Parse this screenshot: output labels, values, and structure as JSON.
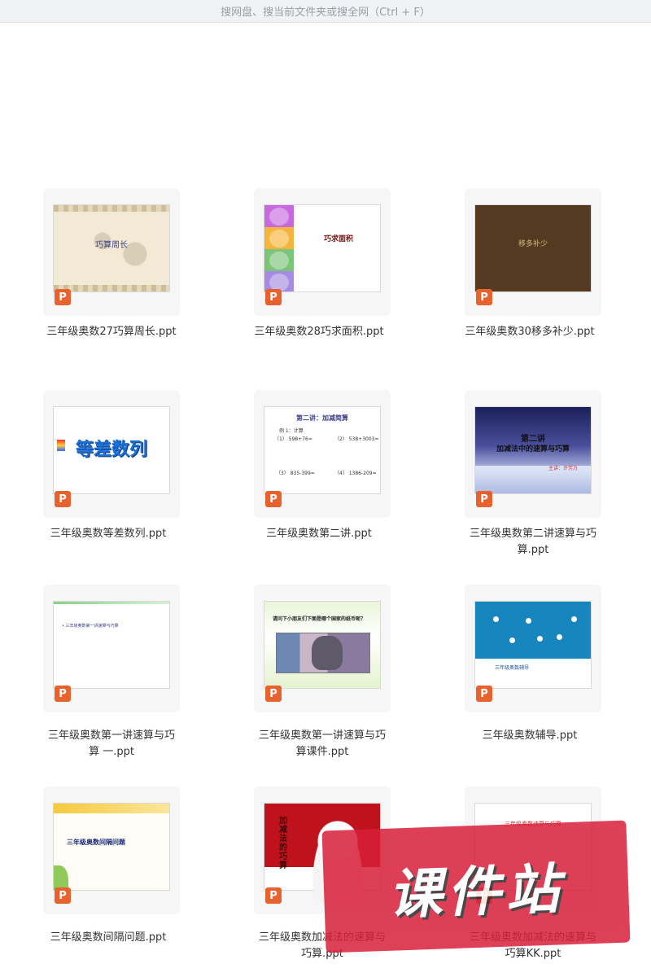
{
  "search": {
    "hint": "搜网盘、搜当前文件夹或搜全网（Ctrl + F）"
  },
  "files": [
    {
      "name": "三年级奥数27巧算周长.ppt",
      "thumb_title": "巧算周长",
      "icon": "ppt-icon"
    },
    {
      "name": "三年级奥数28巧求面积.ppt",
      "thumb_title": "巧求面积",
      "icon": "ppt-icon"
    },
    {
      "name": "三年级奥数30移多补少.ppt",
      "thumb_title": "移多补少",
      "icon": "ppt-icon"
    },
    {
      "name": "三年级奥数等差数列.ppt",
      "thumb_title": "等差数列",
      "icon": "ppt-icon"
    },
    {
      "name": "三年级奥数第二讲.ppt",
      "thumb_title": "第二讲：加减简算",
      "thumb_lines": [
        "例 1：计算",
        "（1） 598+76=",
        "（2） 538+3003=",
        "（3） 835-399=",
        "（4） 1386-209="
      ],
      "icon": "ppt-icon"
    },
    {
      "name": "三年级奥数第二讲速算与巧算.ppt",
      "thumb_title": "第二讲",
      "thumb_subtitle": "加减法中的速算与巧算",
      "thumb_author": "主讲：许芳方",
      "icon": "ppt-icon"
    },
    {
      "name": "三年级奥数第一讲速算与巧算 一.ppt",
      "thumb_title": "三年级奥数第一讲速算与巧算",
      "icon": "ppt-icon"
    },
    {
      "name": "三年级奥数第一讲速算与巧算课件.ppt",
      "thumb_title": "请问下小朋友们下面是哪个国家的纸币呢？",
      "icon": "ppt-icon"
    },
    {
      "name": "三年级奥数辅导.ppt",
      "thumb_title": "三年级奥数辅导",
      "icon": "ppt-icon"
    },
    {
      "name": "三年级奥数间隔问题.ppt",
      "thumb_title": "三年级奥数间隔问题",
      "icon": "ppt-icon"
    },
    {
      "name": "三年级奥数加减法的速算与巧算.ppt",
      "thumb_title": "加减法的巧算",
      "icon": "ppt-icon"
    },
    {
      "name": "三年级奥数加减法的速算与巧算KK.ppt",
      "thumb_title": "三年级奥数速算与巧算",
      "icon": "ppt-icon"
    }
  ],
  "watermark": {
    "text": "课件站"
  },
  "colors": {
    "ppt_icon": "#e8622d",
    "card_bg": "#f6f6f7",
    "watermark": "#d81e3a"
  }
}
